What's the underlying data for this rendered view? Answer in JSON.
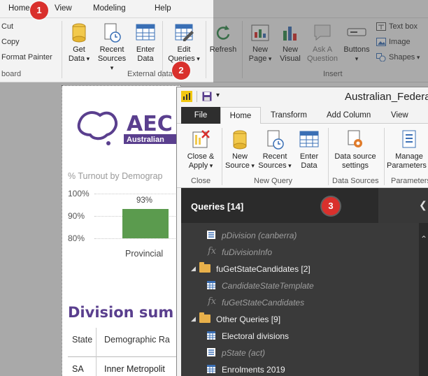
{
  "pbi": {
    "tabs": [
      "Home",
      "View",
      "Modeling",
      "Help"
    ],
    "clipboard": {
      "cut": "Cut",
      "copy": "Copy",
      "format_painter": "Format Painter",
      "group": "board"
    },
    "get_data": {
      "line1": "Get",
      "line2": "Data"
    },
    "recent_sources": {
      "line1": "Recent",
      "line2": "Sources"
    },
    "enter_data": {
      "line1": "Enter",
      "line2": "Data"
    },
    "edit_queries": {
      "line1": "Edit",
      "line2": "Queries"
    },
    "external_group": "External data",
    "refresh": "Refresh",
    "new_page": {
      "line1": "New",
      "line2": "Page"
    },
    "new_visual": {
      "line1": "New",
      "line2": "Visual"
    },
    "ask_question": {
      "line1": "Ask A",
      "line2": "Question"
    },
    "buttons": "Buttons",
    "text_box": "Text box",
    "image": "Image",
    "shapes": "Shapes",
    "insert_group": "Insert"
  },
  "callouts": [
    "1",
    "2",
    "3"
  ],
  "report": {
    "logo_text": "AEC",
    "logo_sub": "Australian",
    "chart_title": "% Turnout by Demograp",
    "division_heading": "Division sum",
    "table_headers": [
      "State",
      "Demographic Ra"
    ],
    "table_rows": [
      [
        "SA",
        "Inner Metropolit"
      ]
    ]
  },
  "chart_data": {
    "type": "bar",
    "categories": [
      "Provincial"
    ],
    "values": [
      93
    ],
    "title": "% Turnout by Demograp",
    "yticks": [
      "100%",
      "90%",
      "80%"
    ],
    "ylim": [
      80,
      100
    ],
    "data_labels": [
      "93%"
    ],
    "bar_color": "#5b9b4e"
  },
  "pq": {
    "title": "Australian_Federal",
    "tabs": [
      "File",
      "Home",
      "Transform",
      "Add Column",
      "View"
    ],
    "close_apply": {
      "line1": "Close &",
      "line2": "Apply"
    },
    "new_source": {
      "line1": "New",
      "line2": "Source"
    },
    "recent_sources": {
      "line1": "Recent",
      "line2": "Sources"
    },
    "enter_data": {
      "line1": "Enter",
      "line2": "Data"
    },
    "ds_settings": {
      "line1": "Data source",
      "line2": "settings"
    },
    "manage_params": {
      "line1": "Manage",
      "line2": "Parameters"
    },
    "groups": [
      "Close",
      "New Query",
      "Data Sources",
      "Parameters"
    ]
  },
  "queries": {
    "title": "Queries [14]",
    "items": [
      {
        "label": "pDivision (canberra)",
        "kind": "param"
      },
      {
        "label": "fuDivisionInfo",
        "kind": "func"
      },
      {
        "label": "fuGetStateCandidates [2]",
        "kind": "folder"
      },
      {
        "label": "CandidateStateTemplate",
        "kind": "table-dim"
      },
      {
        "label": "fuGetStateCandidates",
        "kind": "func"
      },
      {
        "label": "Other Queries [9]",
        "kind": "folder"
      },
      {
        "label": "Electoral divisions",
        "kind": "table"
      },
      {
        "label": "pState (act)",
        "kind": "param"
      },
      {
        "label": "Enrolments 2019",
        "kind": "table"
      }
    ]
  },
  "colors": {
    "accent_red": "#d9302c",
    "aec_purple": "#5a3f8e",
    "folder": "#e8b04a"
  }
}
